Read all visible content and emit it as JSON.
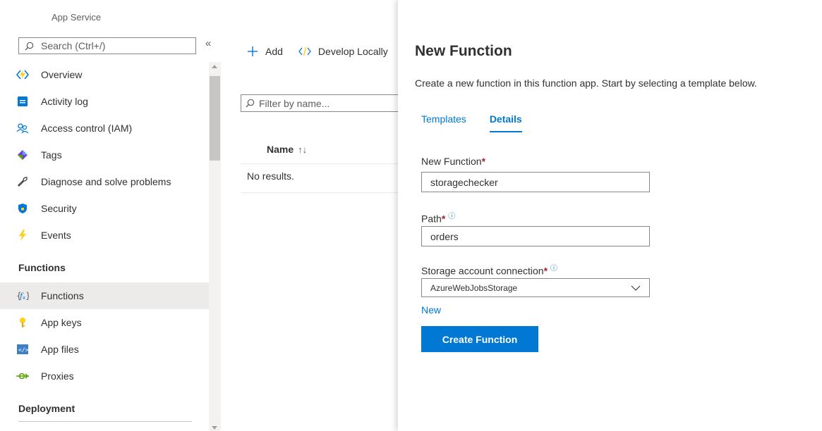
{
  "app": {
    "label": "App Service"
  },
  "left_nav": {
    "search_placeholder": "Search (Ctrl+/)",
    "collapse_glyph": "«",
    "items": [
      {
        "label": "Overview",
        "icon": "overview-icon"
      },
      {
        "label": "Activity log",
        "icon": "activity-log-icon"
      },
      {
        "label": "Access control (IAM)",
        "icon": "access-control-icon"
      },
      {
        "label": "Tags",
        "icon": "tags-icon"
      },
      {
        "label": "Diagnose and solve problems",
        "icon": "wrench-icon"
      },
      {
        "label": "Security",
        "icon": "shield-icon"
      },
      {
        "label": "Events",
        "icon": "lightning-icon"
      }
    ],
    "section_functions": "Functions",
    "function_items": [
      {
        "label": "Functions",
        "icon": "function-icon",
        "selected": true
      },
      {
        "label": "App keys",
        "icon": "key-icon"
      },
      {
        "label": "App files",
        "icon": "code-file-icon"
      },
      {
        "label": "Proxies",
        "icon": "proxy-icon"
      }
    ],
    "section_deployment": "Deployment"
  },
  "toolbar": {
    "add_label": "Add",
    "develop_label": "Develop Locally"
  },
  "list": {
    "filter_placeholder": "Filter by name...",
    "column_name": "Name",
    "sort_glyph": "↑↓",
    "empty_text": "No results."
  },
  "panel": {
    "title": "New Function",
    "description": "Create a new function in this function app. Start by selecting a template below.",
    "tabs": [
      {
        "label": "Templates",
        "active": false
      },
      {
        "label": "Details",
        "active": true
      }
    ],
    "fields": {
      "name_label": "New Function",
      "name_value": "storagechecker",
      "path_label": "Path",
      "path_value": "orders",
      "storage_label": "Storage account connection",
      "storage_value": "AzureWebJobsStorage",
      "required_mark": "*",
      "info_glyph": "ⓘ"
    },
    "new_link": "New",
    "create_button": "Create Function"
  },
  "colors": {
    "accent": "#0078d4",
    "required": "#a4262c",
    "selected_bg": "#edebe9"
  }
}
